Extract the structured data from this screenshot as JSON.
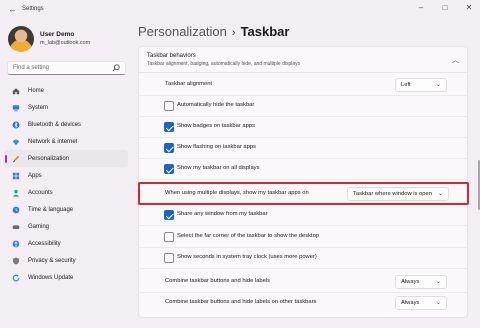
{
  "window": {
    "title": "Settings"
  },
  "user": {
    "name": "User Demo",
    "email": "m_lab@outlook.com"
  },
  "search": {
    "placeholder": "Find a setting"
  },
  "nav": [
    {
      "label": "Home",
      "icon": "home-icon",
      "color": "#5a5a5a",
      "active": false
    },
    {
      "label": "System",
      "icon": "system-icon",
      "color": "#2f7de1",
      "active": false
    },
    {
      "label": "Bluetooth & devices",
      "icon": "bluetooth-icon",
      "color": "#1e6fd0",
      "active": false
    },
    {
      "label": "Network & internet",
      "icon": "network-icon",
      "color": "#3a8bd8",
      "active": false
    },
    {
      "label": "Personalization",
      "icon": "brush-icon",
      "color": "#e08a2a",
      "active": true
    },
    {
      "label": "Apps",
      "icon": "apps-icon",
      "color": "#4b6fb5",
      "active": false
    },
    {
      "label": "Accounts",
      "icon": "accounts-icon",
      "color": "#2fa36b",
      "active": false
    },
    {
      "label": "Time & language",
      "icon": "clock-icon",
      "color": "#2f7de1",
      "active": false
    },
    {
      "label": "Gaming",
      "icon": "gaming-icon",
      "color": "#6a6a6a",
      "active": false
    },
    {
      "label": "Accessibility",
      "icon": "accessibility-icon",
      "color": "#2f7de1",
      "active": false
    },
    {
      "label": "Privacy & security",
      "icon": "shield-icon",
      "color": "#7a7a7a",
      "active": false
    },
    {
      "label": "Windows Update",
      "icon": "update-icon",
      "color": "#2f7de1",
      "active": false
    }
  ],
  "breadcrumb": {
    "parent": "Personalization",
    "separator": "›",
    "current": "Taskbar"
  },
  "section": {
    "title": "Taskbar behaviors",
    "description": "Taskbar alignment, badging, automatically hide, and multiple displays"
  },
  "settings": {
    "alignment": {
      "label": "Taskbar alignment",
      "value": "Left"
    },
    "auto_hide": {
      "label": "Automatically hide the taskbar",
      "checked": false
    },
    "badges": {
      "label": "Show badges on taskbar apps",
      "checked": true
    },
    "flashing": {
      "label": "Show flashing on taskbar apps",
      "checked": true
    },
    "all_displays": {
      "label": "Show my taskbar on all displays",
      "checked": true
    },
    "multi_display": {
      "label": "When using multiple displays, show my taskbar apps on",
      "value": "Taskbar where window is open"
    },
    "share_window": {
      "label": "Share any window from my taskbar",
      "checked": true
    },
    "far_corner": {
      "label": "Select the far corner of the taskbar to show the desktop",
      "checked": false
    },
    "seconds": {
      "label": "Show seconds in system tray clock (uses more power)",
      "checked": false
    },
    "combine": {
      "label": "Combine taskbar buttons and hide labels",
      "value": "Always"
    },
    "combine_other": {
      "label": "Combine taskbar buttons and hide labels on other taskbars",
      "value": "Always"
    }
  },
  "colors": {
    "accent": "#1c64c8",
    "highlight": "#d8262f",
    "nav_indicator": "#b0358a"
  }
}
